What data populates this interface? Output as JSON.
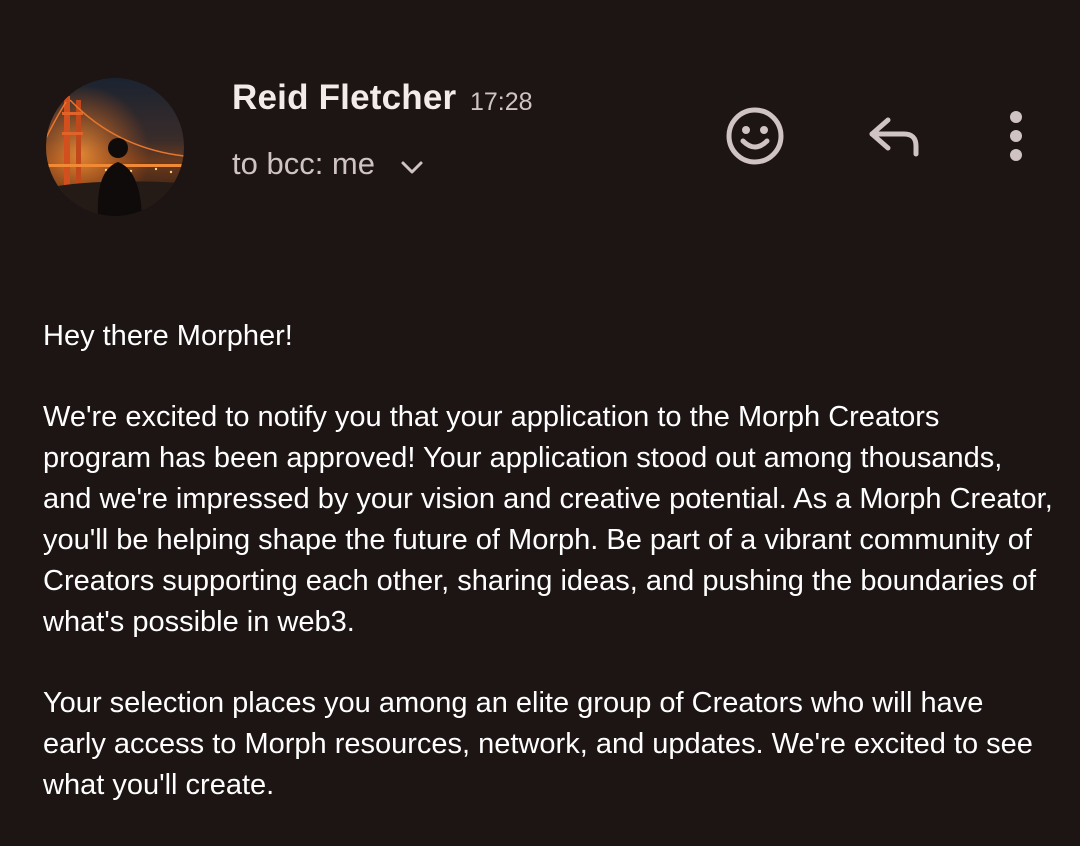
{
  "message": {
    "sender_name": "Reid Fletcher",
    "time": "17:28",
    "recipients_label": "to bcc: me",
    "avatar_icon": "avatar-photo-golden-gate-bridge",
    "actions": {
      "emoji_icon": "smiley-face-icon",
      "reply_icon": "reply-arrow-icon",
      "more_icon": "more-vertical-icon"
    },
    "body": {
      "greeting": "Hey there Morpher!",
      "paragraph_1": "We're excited to notify you that your application to the Morph Creators program has been approved! Your application stood out among thousands, and we're impressed by your vision and creative potential. As a Morph Creator, you'll be helping shape the future of Morph. Be part of a vibrant community of Creators supporting each other, sharing ideas, and pushing the boundaries of what's possible in web3.",
      "paragraph_2": "Your selection places you among an elite group of Creators who will have early access to Morph resources, network, and updates. We're excited to see what you'll create."
    }
  },
  "colors": {
    "background": "#1d1414",
    "text_primary": "#ffffff",
    "text_secondary": "#cfc3c3",
    "icon": "#cfc3c3"
  }
}
